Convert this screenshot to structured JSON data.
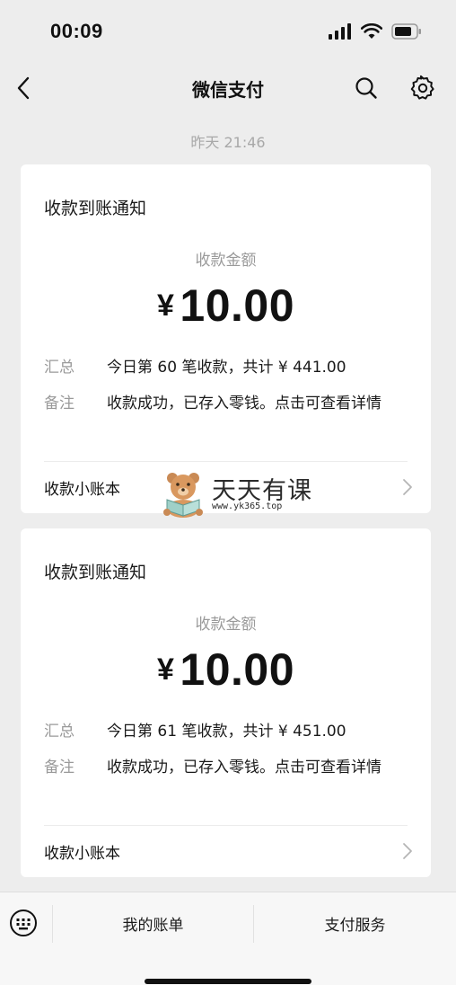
{
  "status_bar": {
    "time": "00:09",
    "icons": [
      "signal-icon",
      "wifi-icon",
      "battery-icon"
    ]
  },
  "nav": {
    "title": "微信支付",
    "icons": [
      "back-icon",
      "search-icon",
      "settings-icon"
    ]
  },
  "timestamp": "昨天 21:46",
  "cards": [
    {
      "header": "收款到账通知",
      "amount_label": "收款金额",
      "currency": "¥",
      "amount": "10.00",
      "summary_key": "汇总",
      "summary_value": "今日第 60 笔收款，共计 ¥ 441.00",
      "remark_key": "备注",
      "remark_value": "收款成功，已存入零钱。点击可查看详情",
      "ledger_label": "收款小账本"
    },
    {
      "header": "收款到账通知",
      "amount_label": "收款金额",
      "currency": "¥",
      "amount": "10.00",
      "summary_key": "汇总",
      "summary_value": "今日第 61 笔收款，共计 ¥ 451.00",
      "remark_key": "备注",
      "remark_value": "收款成功，已存入零钱。点击可查看详情",
      "ledger_label": "收款小账本"
    }
  ],
  "watermark": {
    "text": "天天有课",
    "url": "www.yk365.top"
  },
  "bottom_bar": {
    "bills_label": "我的账单",
    "services_label": "支付服务"
  },
  "colors": {
    "background": "#ededed",
    "card": "#ffffff",
    "muted_text": "#9a9a9a"
  }
}
